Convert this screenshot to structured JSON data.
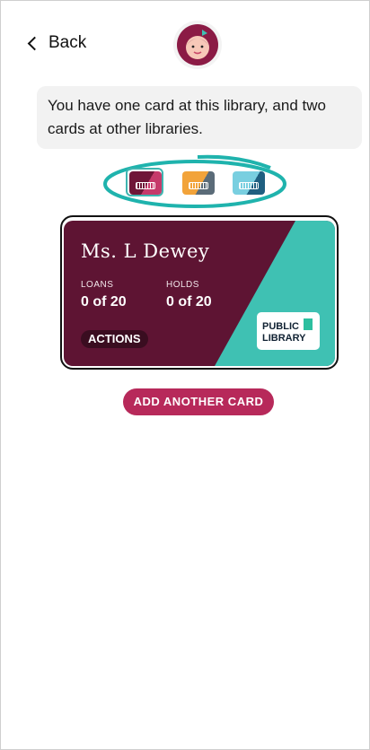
{
  "nav": {
    "back_label": "Back"
  },
  "message": {
    "text": "You have one card at this library, and two cards at other libraries."
  },
  "card": {
    "name": "Ms. L Dewey",
    "loans_label": "LOANS",
    "loans_value": "0 of 20",
    "holds_label": "HOLDS",
    "holds_value": "0 of 20",
    "actions_label": "ACTIONS",
    "library_line1": "PUBLIC",
    "library_line2": "LIBRARY",
    "colors": {
      "primary": "#5e1433",
      "accent": "#3fc1b3"
    }
  },
  "card_picker": {
    "cards": [
      {
        "icon": "library-card-maroon-icon",
        "selected": true
      },
      {
        "icon": "library-card-orange-icon",
        "selected": false
      },
      {
        "icon": "library-card-blue-icon",
        "selected": false
      }
    ]
  },
  "add_card": {
    "label": "ADD ANOTHER CARD"
  }
}
